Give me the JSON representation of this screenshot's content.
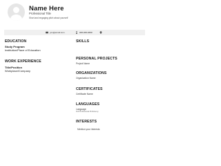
{
  "header": {
    "name": "Name Here",
    "title": "Professional Title",
    "pitch": "Short and engaging pitch about yourself"
  },
  "contact": {
    "email": "you@email.com",
    "phone": "###-###-####",
    "location": ""
  },
  "left": {
    "education_title": "EDUCATION",
    "study_program": "Study Program",
    "institution": "Institution/Place of Education",
    "experience_title": "WORK EXPERIENCE",
    "position": "Title/Position",
    "workplace": "Workplace/Company"
  },
  "right": {
    "skills_title": "SKILLS",
    "projects_title": "PERSONAL PROJECTS",
    "project_name": "Project Name",
    "organizations_title": "ORGANIZATIONS",
    "organization_name": "Organization Name",
    "certificates_title": "CERTIFICATES",
    "certificate_name": "Certificate Name",
    "languages_title": "LANGUAGES",
    "language": "Language",
    "proficiency": "Full Professional Proficiency",
    "interests_title": "INTERESTS",
    "interest": "Mention your interests"
  },
  "icons": {
    "email": "envelope-icon",
    "phone": "phone-icon",
    "location": "location-pin-icon"
  }
}
